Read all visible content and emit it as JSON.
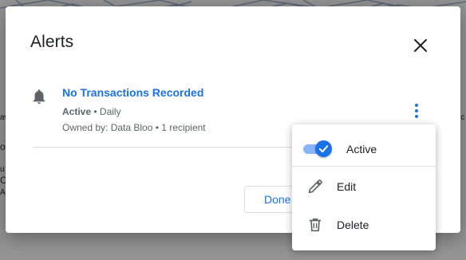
{
  "dialog": {
    "title": "Alerts",
    "close_icon": "close-icon"
  },
  "alert": {
    "icon": "bell-icon",
    "name": "No Transactions Recorded",
    "status": "Active",
    "frequency": " • Daily",
    "owner": "Owned by: Data Bloo • 1 recipient",
    "more_icon": "more-vert-icon"
  },
  "footer": {
    "done_label": "Done"
  },
  "menu": {
    "items": [
      {
        "label": "Active",
        "icon": "toggle-icon",
        "checked": true
      },
      {
        "label": "Edit",
        "icon": "pencil-icon"
      },
      {
        "label": "Delete",
        "icon": "trash-icon"
      }
    ]
  },
  "colors": {
    "accent": "#1a73e8",
    "toggle_track": "#8ab4f8",
    "text_primary": "#202124",
    "text_secondary": "#5f6368"
  }
}
